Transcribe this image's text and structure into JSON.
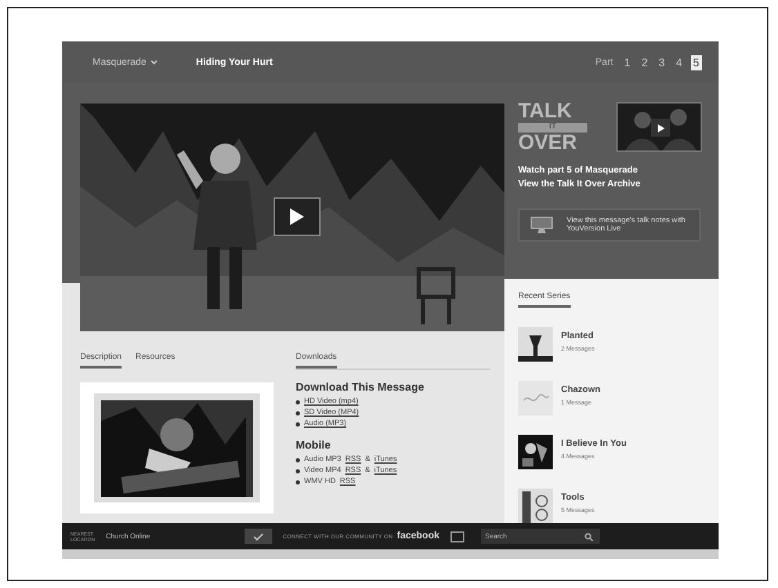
{
  "header": {
    "series": "Masquerade",
    "title": "Hiding Your Hurt",
    "parts_label": "Part",
    "parts": [
      {
        "label": "1",
        "selected": false
      },
      {
        "label": "2",
        "selected": false
      },
      {
        "label": "3",
        "selected": false
      },
      {
        "label": "4",
        "selected": false
      },
      {
        "label": "5",
        "selected": true
      }
    ]
  },
  "talk_it_over": {
    "logo": [
      "TALK",
      "IT",
      "OVER"
    ],
    "links": [
      "Watch part 5 of Masquerade",
      "View the Talk It Over Archive"
    ],
    "notes_button": "View this message's talk notes with YouVersion Live"
  },
  "tabs": [
    {
      "label": "Description",
      "selected": true
    },
    {
      "label": "Resources",
      "selected": false
    }
  ],
  "downloads": {
    "heading": "Downloads",
    "title": "Download This Message",
    "links": [
      "HD Video (mp4)",
      "SD Video (MP4)",
      "Audio (MP3)"
    ],
    "mobile_title": "Mobile",
    "mobile_links": [
      [
        {
          "text": "Audio MP3",
          "link": false
        },
        {
          "text": "RSS",
          "link": true
        },
        {
          "text": "&",
          "link": false
        },
        {
          "text": "iTunes",
          "link": true
        }
      ],
      [
        {
          "text": "Video MP4",
          "link": false
        },
        {
          "text": "RSS",
          "link": true
        },
        {
          "text": "&",
          "link": false
        },
        {
          "text": "iTunes",
          "link": true
        }
      ],
      [
        {
          "text": "WMV HD",
          "link": false
        },
        {
          "text": "RSS",
          "link": true
        }
      ]
    ]
  },
  "recent_series": {
    "heading": "Recent Series",
    "items": [
      {
        "title": "Planted",
        "count": "2 Messages"
      },
      {
        "title": "Chazown",
        "count": "1 Message"
      },
      {
        "title": "I Believe In You",
        "count": "4 Messages"
      },
      {
        "title": "Tools",
        "count": "5 Messages"
      }
    ]
  },
  "footer": {
    "location_label": [
      "NEAREST",
      "LOCATION"
    ],
    "location": "Church Online",
    "connect": "CONNECT WITH OUR COMMUNITY ON",
    "facebook": "facebook",
    "search": {
      "placeholder": "Search"
    }
  }
}
